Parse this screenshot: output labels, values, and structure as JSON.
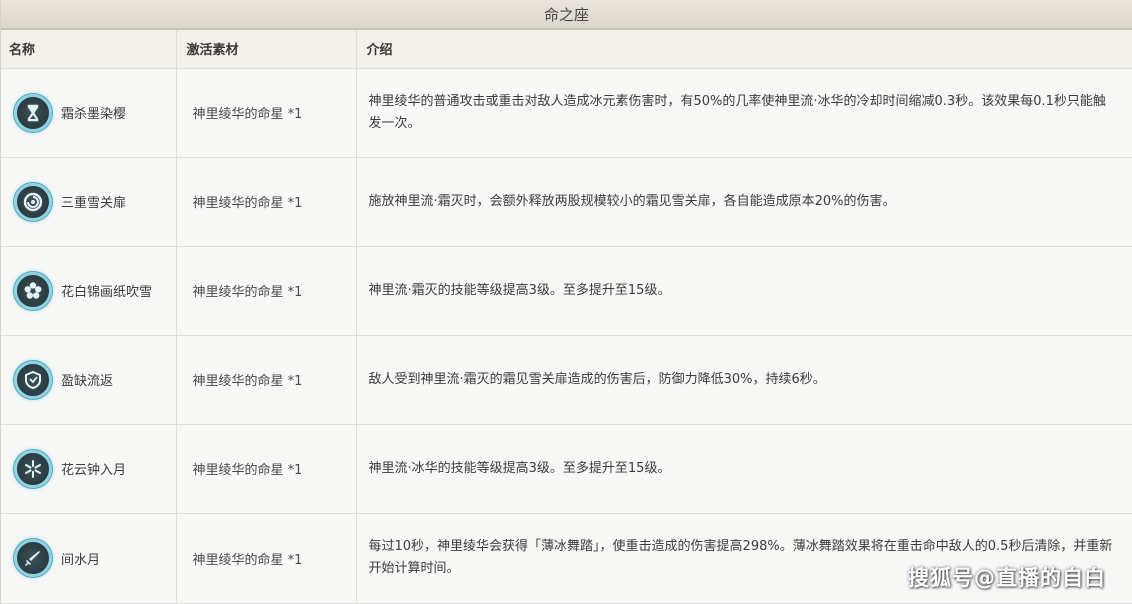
{
  "title": "命之座",
  "headers": {
    "name": "名称",
    "material": "激活素材",
    "desc": "介绍"
  },
  "rows": [
    {
      "icon": "hourglass-icon",
      "name": "霜杀墨染樱",
      "material": "神里绫华的命星 *1",
      "desc": "神里绫华的普通攻击或重击对敌人造成冰元素伤害时，有50%的几率使神里流·冰华的冷却时间缩减0.3秒。该效果每0.1秒只能触发一次。"
    },
    {
      "icon": "swirl-icon",
      "name": "三重雪关扉",
      "material": "神里绫华的命星 *1",
      "desc": "施放神里流·霜灭时，会额外释放两股规模较小的霜见雪关扉，各自能造成原本20%的伤害。"
    },
    {
      "icon": "flower-icon",
      "name": "花白锦画纸吹雪",
      "material": "神里绫华的命星 *1",
      "desc": "神里流·霜灭的技能等级提高3级。至多提升至15级。"
    },
    {
      "icon": "shield-icon",
      "name": "盈缺流返",
      "material": "神里绫华的命星 *1",
      "desc": "敌人受到神里流·霜灭的霜见雪关扉造成的伤害后，防御力降低30%，持续6秒。"
    },
    {
      "icon": "snowflake-icon",
      "name": "花云钟入月",
      "material": "神里绫华的命星 *1",
      "desc": "神里流·冰华的技能等级提高3级。至多提升至15级。"
    },
    {
      "icon": "sword-icon",
      "name": "间水月",
      "material": "神里绫华的命星 *1",
      "desc": "每过10秒，神里绫华会获得「薄冰舞踏」，使重击造成的伤害提高298%。薄冰舞踏效果将在重击命中敌人的0.5秒后清除，并重新开始计算时间。"
    }
  ],
  "watermark": "搜狐号@直播的自白"
}
